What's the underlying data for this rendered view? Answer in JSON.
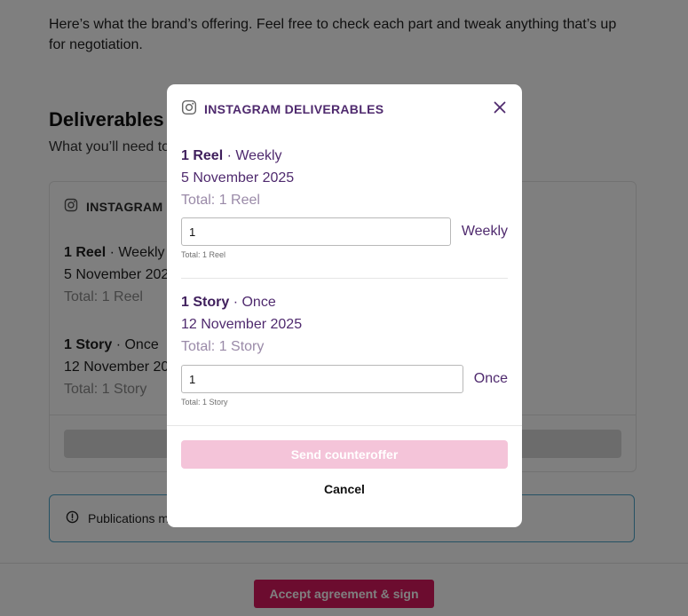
{
  "background": {
    "intro_text": "Here’s what the brand’s offering. Feel free to check each part and tweak anything that’s up for negotiation.",
    "section_title": "Deliverables",
    "section_subtitle": "What you’ll need to",
    "card": {
      "header": "INSTAGRAM",
      "items": [
        {
          "count": "1 Reel",
          "sep": " · ",
          "frequency": "Weekly",
          "date": "5 November 2025",
          "total": "Total: 1 Reel"
        },
        {
          "count": "1 Story",
          "sep": " · ",
          "frequency": "Once",
          "date": "12 November 2025",
          "total": "Total: 1 Story"
        }
      ]
    },
    "notice_text": "Publications m",
    "accept_label": "Accept agreement & sign"
  },
  "modal": {
    "title": "INSTAGRAM DELIVERABLES",
    "items": [
      {
        "count": "1 Reel",
        "sep": " · ",
        "frequency": "Weekly",
        "date": "5 November 2025",
        "total": "Total: 1 Reel",
        "input_value": "1",
        "unit": "Weekly",
        "hint": "Total: 1 Reel"
      },
      {
        "count": "1 Story",
        "sep": " · ",
        "frequency": "Once",
        "date": "12 November 2025",
        "total": "Total: 1 Story",
        "input_value": "1",
        "unit": "Once",
        "hint": "Total: 1 Story"
      }
    ],
    "send_label": "Send counteroffer",
    "cancel_label": "Cancel"
  },
  "colors": {
    "brand": "#d8195f",
    "brand_disabled": "#f4c4d9",
    "modal_text": "#4f2a6e",
    "notice_border": "#4aa3c9"
  }
}
